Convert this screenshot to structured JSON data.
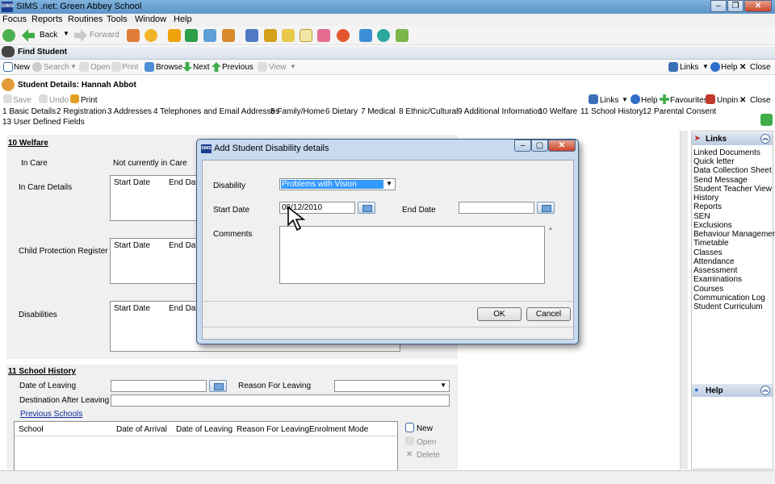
{
  "window": {
    "title": "SIMS .net: Green Abbey School",
    "logo_text": "SIMS"
  },
  "menu": [
    "Focus",
    "Reports",
    "Routines",
    "Tools",
    "Window",
    "Help"
  ],
  "nav": {
    "back": "Back",
    "forward": "Forward"
  },
  "find": {
    "title": "Find Student",
    "toolbar": {
      "new": "New",
      "search": "Search",
      "open": "Open",
      "print": "Print",
      "browse": "Browse",
      "next": "Next",
      "previous": "Previous",
      "view": "View",
      "links": "Links",
      "help": "Help",
      "close": "Close"
    }
  },
  "details": {
    "title": "Student Details: Hannah Abbot",
    "toolbar": {
      "save": "Save",
      "undo": "Undo",
      "print": "Print",
      "links": "Links",
      "help": "Help",
      "favourites": "Favourites",
      "unpin": "Unpin",
      "close": "Close"
    }
  },
  "tabs": [
    "1 Basic Details",
    "2 Registration",
    "3 Addresses",
    "4 Telephones and Email Addresses",
    "5 Family/Home",
    "6 Dietary",
    "7 Medical",
    "8 Ethnic/Cultural",
    "9 Additional Information",
    "10 Welfare",
    "11 School History",
    "12 Parental Consent",
    "13 User Defined Fields"
  ],
  "welfare": {
    "heading": "10 Welfare",
    "in_care_label": "In Care",
    "in_care_value": "Not currently in Care",
    "in_care_details_label": "In Care Details",
    "cpr_label": "Child Protection Register",
    "disabilities_label": "Disabilities",
    "col_start": "Start Date",
    "col_end": "End Date"
  },
  "school_history": {
    "heading": "11 School History",
    "date_leaving_label": "Date of Leaving",
    "reason_label": "Reason For Leaving",
    "destination_label": "Destination After Leaving",
    "previous_schools_link": "Previous Schools",
    "columns": [
      "School",
      "Date of Arrival",
      "Date of Leaving",
      "Reason For Leaving",
      "Enrolment Mode"
    ],
    "actions": {
      "new": "New",
      "open": "Open",
      "delete": "Delete"
    }
  },
  "sidebar": {
    "links_title": "Links",
    "links": [
      "Linked Documents",
      "Quick letter",
      "Data Collection Sheet",
      "Send Message",
      "Student Teacher View",
      "History",
      "Reports",
      "SEN",
      "Exclusions",
      "Behaviour Management",
      "Timetable",
      "Classes",
      "Attendance",
      "Assessment",
      "Examinations",
      "Courses",
      "Communication Log",
      "Student Curriculum"
    ],
    "help_title": "Help"
  },
  "dialog": {
    "title": "Add Student Disability details",
    "disability_label": "Disability",
    "disability_value": "Problems with Vision",
    "start_label": "Start Date",
    "start_value": "08/12/2010",
    "end_label": "End Date",
    "end_value": "",
    "comments_label": "Comments",
    "ok": "OK",
    "cancel": "Cancel"
  },
  "colors": {
    "accent": "#3399ff",
    "titlebar": "#6a9fd0",
    "link": "#0a2a9a"
  }
}
